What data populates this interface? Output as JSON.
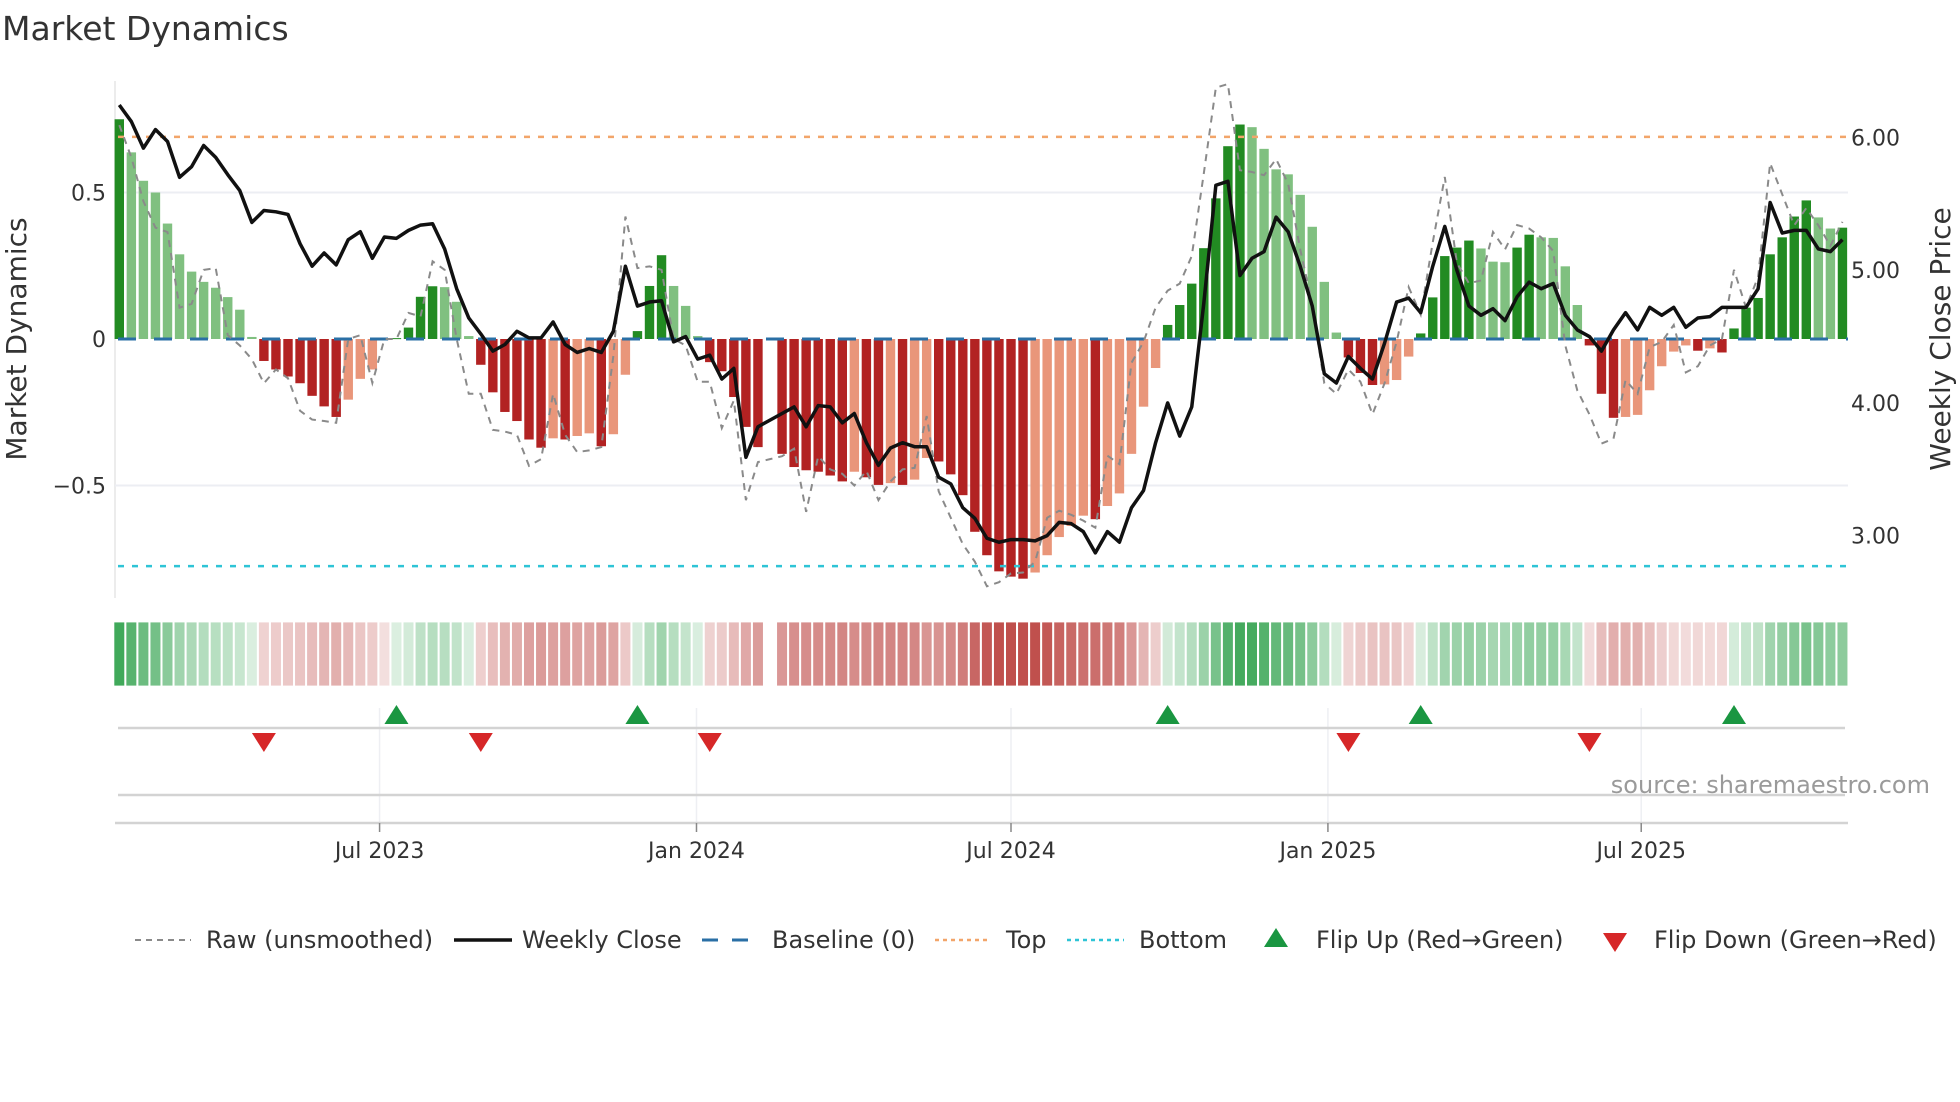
{
  "chart_data": {
    "type": "bar",
    "title": "Market Dynamics",
    "ylabel": "Market Dynamics",
    "ylabel_right": "Weekly Close Price",
    "source": "source: sharemaestro.com",
    "frequency": "weekly",
    "start_date": "2023-01-27",
    "ylim": [
      -0.88,
      0.88
    ],
    "ylim_right": [
      2.54,
      6.42
    ],
    "yticks": [
      {
        "value": 0.5,
        "label": "0.5"
      },
      {
        "value": 0,
        "label": "0"
      },
      {
        "value": -0.5,
        "label": "−0.5"
      }
    ],
    "yticks_right": [
      {
        "value": 6,
        "label": "6.00"
      },
      {
        "value": 5,
        "label": "5.00"
      },
      {
        "value": 4,
        "label": "4.00"
      },
      {
        "value": 3,
        "label": "3.00"
      }
    ],
    "xticks": [
      {
        "week_index": 21.6,
        "label": "Jul 2023"
      },
      {
        "week_index": 47.9,
        "label": "Jan 2024"
      },
      {
        "week_index": 74.0,
        "label": "Jul 2024"
      },
      {
        "week_index": 100.3,
        "label": "Jan 2025"
      },
      {
        "week_index": 126.3,
        "label": "Jul 2025"
      }
    ],
    "top_level": 0.69,
    "bottom_level": -0.775,
    "baseline": 0,
    "grid": true,
    "legend_position": "bottom",
    "legend": [
      "Raw (unsmoothed)",
      "Weekly Close",
      "Baseline (0)",
      "Top",
      "Bottom",
      "Flip Up (Red→Green)",
      "Flip Down (Green→Red)"
    ],
    "colors": {
      "pos_strong": "#228b22",
      "pos_weak": "#80c080",
      "neg_strong": "#b22222",
      "neg_weak": "#e9967a",
      "raw": "#8a8a8a",
      "close": "#111111",
      "baseline": "#2a6fa5",
      "top": "#f2a56a",
      "bottom": "#2ec4d6",
      "flip_up": "#1a9641",
      "flip_down": "#d62728",
      "strip_pos": "#3aa655",
      "strip_neg": "#c0504d"
    },
    "series": [
      {
        "name": "Market Dynamics",
        "values": [
          0.75,
          0.637,
          0.54,
          0.5,
          0.394,
          0.289,
          0.23,
          0.195,
          0.175,
          0.143,
          0.1,
          0.007,
          -0.075,
          -0.104,
          -0.128,
          -0.151,
          -0.194,
          -0.23,
          -0.266,
          -0.207,
          -0.136,
          -0.104,
          -0.004,
          0.003,
          0.039,
          0.144,
          0.18,
          0.177,
          0.127,
          0.01,
          -0.088,
          -0.182,
          -0.249,
          -0.28,
          -0.343,
          -0.371,
          -0.339,
          -0.343,
          -0.331,
          -0.322,
          -0.366,
          -0.325,
          -0.122,
          0.027,
          0.181,
          0.286,
          0.181,
          0.113,
          0.01,
          -0.079,
          -0.11,
          -0.198,
          -0.3,
          -0.369,
          null,
          -0.392,
          -0.437,
          -0.448,
          -0.453,
          -0.466,
          -0.486,
          -0.453,
          -0.472,
          -0.498,
          -0.492,
          -0.498,
          -0.48,
          -0.406,
          -0.418,
          -0.462,
          -0.533,
          -0.658,
          -0.738,
          -0.793,
          -0.811,
          -0.818,
          -0.797,
          -0.738,
          -0.676,
          -0.638,
          -0.603,
          -0.615,
          -0.57,
          -0.527,
          -0.392,
          -0.231,
          -0.099,
          0.048,
          0.116,
          0.189,
          0.31,
          0.48,
          0.658,
          0.732,
          0.723,
          0.649,
          0.579,
          0.562,
          0.492,
          0.383,
          0.195,
          0.022,
          -0.063,
          -0.116,
          -0.157,
          -0.155,
          -0.14,
          -0.06,
          0.019,
          0.142,
          0.283,
          0.312,
          0.336,
          0.309,
          0.264,
          0.262,
          0.312,
          0.356,
          0.347,
          0.345,
          0.248,
          0.116,
          -0.022,
          -0.187,
          -0.269,
          -0.266,
          -0.259,
          -0.175,
          -0.093,
          -0.043,
          -0.022,
          -0.04,
          -0.032,
          -0.046,
          0.036,
          0.107,
          0.14,
          0.289,
          0.347,
          0.418,
          0.473,
          0.415,
          0.377,
          0.38
        ]
      },
      {
        "name": "Raw (unsmoothed)",
        "values": [
          0.73,
          0.62,
          0.47,
          0.38,
          0.365,
          0.107,
          0.12,
          0.236,
          0.242,
          0.013,
          -0.022,
          -0.069,
          -0.151,
          -0.104,
          -0.134,
          -0.245,
          -0.275,
          -0.28,
          -0.286,
          0.0,
          0.013,
          -0.15,
          0.0,
          0.0,
          0.089,
          0.077,
          0.265,
          0.236,
          0.0,
          -0.187,
          -0.187,
          -0.31,
          -0.316,
          -0.327,
          -0.433,
          -0.41,
          -0.187,
          -0.327,
          -0.386,
          -0.38,
          -0.369,
          -0.058,
          0.418,
          0.242,
          0.248,
          0.236,
          0.0,
          -0.022,
          -0.146,
          -0.146,
          -0.304,
          -0.21,
          -0.55,
          -0.42,
          -0.41,
          -0.4,
          -0.374,
          -0.59,
          -0.4,
          -0.445,
          -0.46,
          -0.5,
          -0.45,
          -0.55,
          -0.486,
          -0.445,
          -0.44,
          -0.263,
          -0.52,
          -0.61,
          -0.7,
          -0.76,
          -0.844,
          -0.83,
          -0.8,
          -0.797,
          -0.76,
          -0.61,
          -0.586,
          -0.6,
          -0.62,
          -0.644,
          -0.398,
          -0.427,
          -0.081,
          -0.01,
          0.107,
          0.165,
          0.189,
          0.283,
          0.565,
          0.858,
          0.87,
          0.576,
          0.57,
          0.559,
          0.614,
          0.53,
          0.306,
          0.119,
          -0.151,
          -0.187,
          -0.104,
          -0.146,
          -0.257,
          -0.151,
          -0.01,
          0.177,
          0.083,
          0.33,
          0.553,
          0.26,
          0.19,
          0.2,
          0.365,
          0.306,
          0.389,
          0.377,
          0.347,
          0.3,
          -0.022,
          -0.176,
          -0.257,
          -0.357,
          -0.34,
          -0.14,
          -0.187,
          -0.028,
          -0.01,
          0.048,
          -0.114,
          -0.093,
          -0.022,
          0.0,
          0.236,
          0.107,
          0.212,
          0.6,
          0.494,
          0.388,
          0.447,
          0.388,
          0.318,
          0.4
        ]
      },
      {
        "name": "Weekly Close",
        "axis": "right",
        "values": [
          6.245,
          6.12,
          5.92,
          6.06,
          5.97,
          5.7,
          5.78,
          5.94,
          5.85,
          5.72,
          5.6,
          5.36,
          5.45,
          5.44,
          5.42,
          5.2,
          5.03,
          5.13,
          5.04,
          5.23,
          5.29,
          5.09,
          5.25,
          5.24,
          5.3,
          5.34,
          5.35,
          5.16,
          4.86,
          4.64,
          4.52,
          4.39,
          4.44,
          4.54,
          4.49,
          4.49,
          4.61,
          4.44,
          4.38,
          4.41,
          4.38,
          4.54,
          5.03,
          4.73,
          4.76,
          4.77,
          4.46,
          4.5,
          4.33,
          4.36,
          4.18,
          4.26,
          3.59,
          3.82,
          3.87,
          3.92,
          3.97,
          3.82,
          3.98,
          3.97,
          3.85,
          3.92,
          3.7,
          3.53,
          3.66,
          3.7,
          3.67,
          3.67,
          3.44,
          3.39,
          3.21,
          3.13,
          2.98,
          2.95,
          2.97,
          2.97,
          2.96,
          3.0,
          3.1,
          3.09,
          3.03,
          2.87,
          3.03,
          2.95,
          3.21,
          3.34,
          3.7,
          4.0,
          3.75,
          3.97,
          4.75,
          5.64,
          5.67,
          4.96,
          5.09,
          5.14,
          5.4,
          5.29,
          5.03,
          4.73,
          4.22,
          4.15,
          4.35,
          4.26,
          4.18,
          4.45,
          4.76,
          4.79,
          4.68,
          5.03,
          5.33,
          5.0,
          4.73,
          4.66,
          4.71,
          4.62,
          4.8,
          4.91,
          4.86,
          4.9,
          4.66,
          4.55,
          4.5,
          4.39,
          4.55,
          4.68,
          4.55,
          4.72,
          4.66,
          4.72,
          4.57,
          4.64,
          4.65,
          4.72,
          4.72,
          4.72,
          4.86,
          5.51,
          5.28,
          5.3,
          5.3,
          5.16,
          5.14,
          5.23
        ]
      }
    ],
    "flip_up_weeks": [
      23,
      43,
      87,
      108,
      134
    ],
    "flip_down_weeks": [
      12,
      30,
      49,
      102,
      122
    ]
  }
}
